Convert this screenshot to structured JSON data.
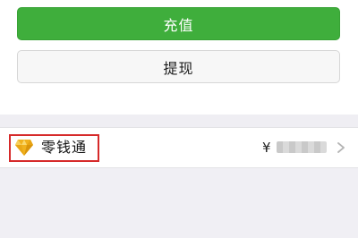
{
  "buttons": {
    "recharge_label": "充值",
    "withdraw_label": "提现"
  },
  "list": {
    "item_label": "零钱通",
    "currency_symbol": "¥",
    "amount": "",
    "item_icon": "diamond-icon",
    "trailing_icon": "chevron-right-icon"
  },
  "colors": {
    "accent_green": "#3fae3c",
    "highlight_red": "#d62a2a",
    "diamond_gold": "#f0b21e",
    "page_background": "#f0eff4"
  }
}
